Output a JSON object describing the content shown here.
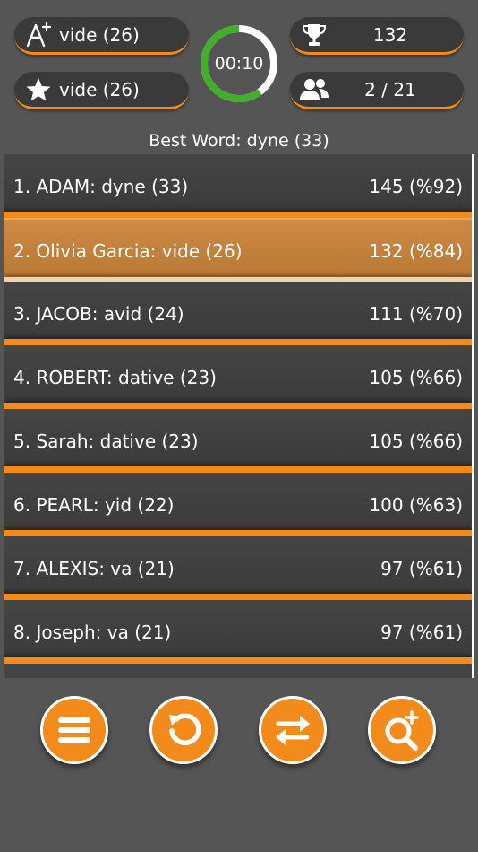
{
  "stats": {
    "score": "vide (26)",
    "best": "vide (26)",
    "trophy": "132",
    "players": "2 / 21"
  },
  "timer": {
    "text": "00:10",
    "progress": 0.6
  },
  "best_word": "Best Word: dyne (33)",
  "leaderboard": [
    {
      "left": "1. ADAM: dyne (33)",
      "right": "145 (%92)"
    },
    {
      "left": "2. Olivia Garcia: vide (26)",
      "right": "132 (%84)"
    },
    {
      "left": "3. JACOB: avid (24)",
      "right": "111 (%70)"
    },
    {
      "left": "4. ROBERT: dative (23)",
      "right": "105 (%66)"
    },
    {
      "left": "5. Sarah: dative (23)",
      "right": "105 (%66)"
    },
    {
      "left": "6. PEARL: yid (22)",
      "right": "100 (%63)"
    },
    {
      "left": "7. ALEXIS: va (21)",
      "right": "97 (%61)"
    },
    {
      "left": "8. Joseph: va (21)",
      "right": "97 (%61)"
    }
  ],
  "colors": {
    "accent": "#f28a1c",
    "timer_ring": "#3fb028",
    "highlight": "#c7843f"
  },
  "icons": [
    "a-plus-icon",
    "star-icon",
    "trophy-icon",
    "players-icon",
    "menu-icon",
    "restart-icon",
    "swap-icon",
    "zoom-plus-icon"
  ]
}
